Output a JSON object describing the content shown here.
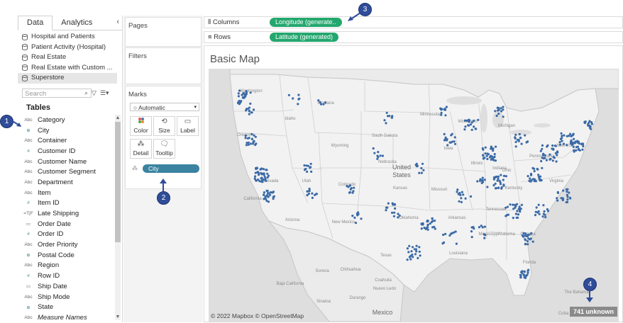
{
  "datapane": {
    "tabs": [
      "Data",
      "Analytics"
    ],
    "collapse_glyph": "‹",
    "sources": [
      {
        "label": "Hospital and Patients",
        "selected": false
      },
      {
        "label": "Patient Activity (Hospital)",
        "selected": false
      },
      {
        "label": "Real Estate",
        "selected": false
      },
      {
        "label": "Real Estate with Custom ...",
        "selected": false
      },
      {
        "label": "Superstore",
        "selected": true
      }
    ],
    "search_placeholder": "Search",
    "tables_header": "Tables",
    "fields": [
      {
        "type": "Abc",
        "label": "Category"
      },
      {
        "type": "globe",
        "label": "City"
      },
      {
        "type": "Abc",
        "label": "Container"
      },
      {
        "type": "#",
        "label": "Customer ID"
      },
      {
        "type": "Abc",
        "label": "Customer Name"
      },
      {
        "type": "Abc",
        "label": "Customer Segment"
      },
      {
        "type": "Abc",
        "label": "Department"
      },
      {
        "type": "Abc",
        "label": "Item"
      },
      {
        "type": "#",
        "label": "Item ID"
      },
      {
        "type": "=T|F",
        "label": "Late Shipping"
      },
      {
        "type": "date",
        "label": "Order Date"
      },
      {
        "type": "#",
        "label": "Order ID"
      },
      {
        "type": "Abc",
        "label": "Order Priority"
      },
      {
        "type": "globe",
        "label": "Postal Code"
      },
      {
        "type": "Abc",
        "label": "Region"
      },
      {
        "type": "#",
        "label": "Row ID"
      },
      {
        "type": "date",
        "label": "Ship Date"
      },
      {
        "type": "Abc",
        "label": "Ship Mode"
      },
      {
        "type": "globe",
        "label": "State"
      },
      {
        "type": "Abc",
        "label": "Measure Names",
        "italic": true
      }
    ]
  },
  "pages_label": "Pages",
  "filters_label": "Filters",
  "marks": {
    "label": "Marks",
    "type": "Automatic",
    "buttons": [
      "Color",
      "Size",
      "Label",
      "Detail",
      "Tooltip"
    ],
    "detail_pill": "City"
  },
  "shelves": {
    "columns_label": "Columns",
    "columns_pill": "Longitude (generate..",
    "rows_label": "Rows",
    "rows_pill": "Latitude (generated)"
  },
  "viz": {
    "title": "Basic Map",
    "credit": "© 2022 Mapbox © OpenStreetMap",
    "unknown": "741 unknown",
    "country_labels": {
      "us1": "United",
      "us2": "States",
      "mexico": "Mexico"
    },
    "state_labels": [
      "Washington",
      "Montana",
      "Idaho",
      "Oregon",
      "Wyoming",
      "South Dakota",
      "Nebraska",
      "Nevada",
      "Utah",
      "Colorado",
      "Kansas",
      "California",
      "Arizona",
      "New Mexico",
      "Oklahoma",
      "Texas",
      "Missouri",
      "Minnesota",
      "Iowa",
      "Illinois",
      "Indiana",
      "Ohio",
      "Michigan",
      "New York",
      "Pennsylvania",
      "Virginia",
      "Tennessee",
      "Mississippi",
      "Alabama",
      "Georgia",
      "Arkansas",
      "Louisiana",
      "Florida",
      "Kentucky",
      "Wisconsin",
      "Baja California",
      "Sonora",
      "Chihuahua",
      "Coahuila",
      "Sinaloa",
      "Durango",
      "Nuevo León",
      "Cuba",
      "The Bahamas"
    ],
    "dot_color": "#3b6aa6"
  },
  "callouts": [
    "1",
    "2",
    "3",
    "4"
  ]
}
